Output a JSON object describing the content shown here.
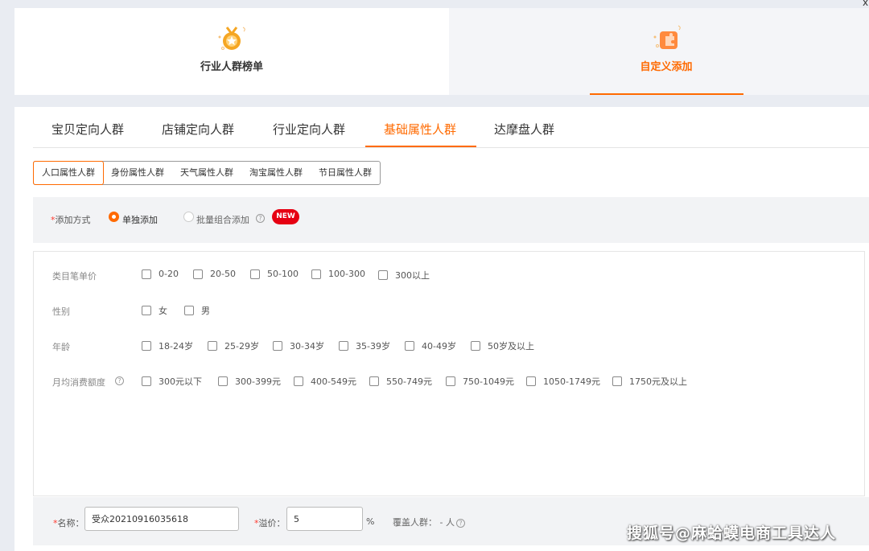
{
  "top_tabs": {
    "industry_rank": "行业人群榜单",
    "custom_add": "自定义添加"
  },
  "tabs": [
    "宝贝定向人群",
    "店铺定向人群",
    "行业定向人群",
    "基础属性人群",
    "达摩盘人群"
  ],
  "active_tab": "基础属性人群",
  "subtabs": [
    "人口属性人群",
    "身份属性人群",
    "天气属性人群",
    "淘宝属性人群",
    "节日属性人群"
  ],
  "active_subtab": "人口属性人群",
  "add_mode": {
    "required_mark": "*",
    "label": "添加方式",
    "single": "单独添加",
    "batch": "批量组合添加",
    "badge": "NEW"
  },
  "filters": {
    "price": {
      "label": "类目笔单价",
      "options": [
        "0-20",
        "20-50",
        "50-100",
        "100-300",
        "300以上"
      ]
    },
    "gender": {
      "label": "性别",
      "options": [
        "女",
        "男"
      ]
    },
    "age": {
      "label": "年龄",
      "options": [
        "18-24岁",
        "25-29岁",
        "30-34岁",
        "35-39岁",
        "40-49岁",
        "50岁及以上"
      ]
    },
    "spend": {
      "label": "月均消费额度",
      "options": [
        "300元以下",
        "300-399元",
        "400-549元",
        "550-749元",
        "750-1049元",
        "1050-1749元",
        "1750元及以上"
      ]
    }
  },
  "footer": {
    "name_label": "名称：",
    "name_value": "受众20210916035618",
    "premium_label": "溢价：",
    "premium_value": "5",
    "premium_unit": "%",
    "cover_label": "覆盖人群：",
    "cover_value": "- 人"
  },
  "help_glyph": "?",
  "watermark": "搜狐号@麻蛤蟆电商工具达人",
  "corner_mark": "x",
  "colors": {
    "accent": "#ff6a00",
    "badge": "#e60012"
  }
}
